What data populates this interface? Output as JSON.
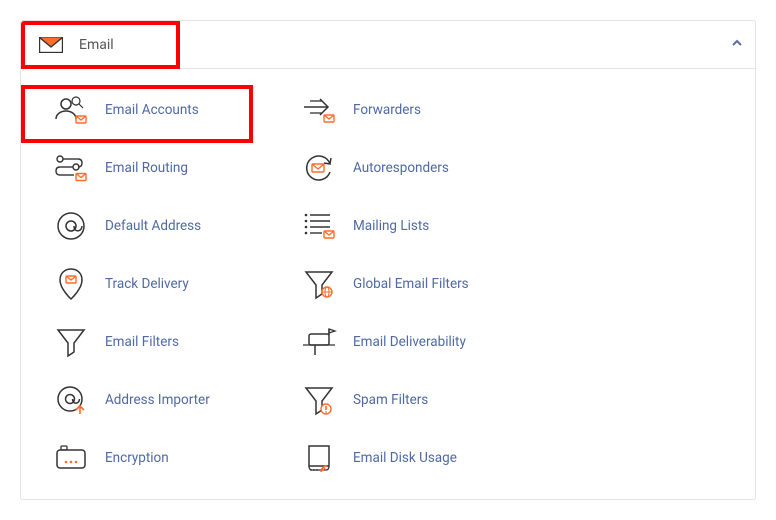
{
  "panel": {
    "title": "Email",
    "icon": "envelope-icon",
    "collapsed": false
  },
  "items": [
    {
      "label": "Email Accounts",
      "icon": "email-accounts-icon"
    },
    {
      "label": "Forwarders",
      "icon": "forwarders-icon"
    },
    {
      "label": "Email Routing",
      "icon": "routing-icon"
    },
    {
      "label": "Autoresponders",
      "icon": "autoresponders-icon"
    },
    {
      "label": "Default Address",
      "icon": "at-icon"
    },
    {
      "label": "Mailing Lists",
      "icon": "mailing-lists-icon"
    },
    {
      "label": "Track Delivery",
      "icon": "track-delivery-icon"
    },
    {
      "label": "Global Email Filters",
      "icon": "global-filters-icon"
    },
    {
      "label": "Email Filters",
      "icon": "filters-icon"
    },
    {
      "label": "Email Deliverability",
      "icon": "deliverability-icon"
    },
    {
      "label": "Address Importer",
      "icon": "address-importer-icon"
    },
    {
      "label": "Spam Filters",
      "icon": "spam-filters-icon"
    },
    {
      "label": "Encryption",
      "icon": "encryption-icon"
    },
    {
      "label": "Email Disk Usage",
      "icon": "disk-usage-icon"
    }
  ],
  "highlight": {
    "header": true,
    "item_index": 0
  },
  "colors": {
    "accent": "#ff6c2c",
    "stroke": "#333333",
    "link": "#4f6aa3"
  }
}
